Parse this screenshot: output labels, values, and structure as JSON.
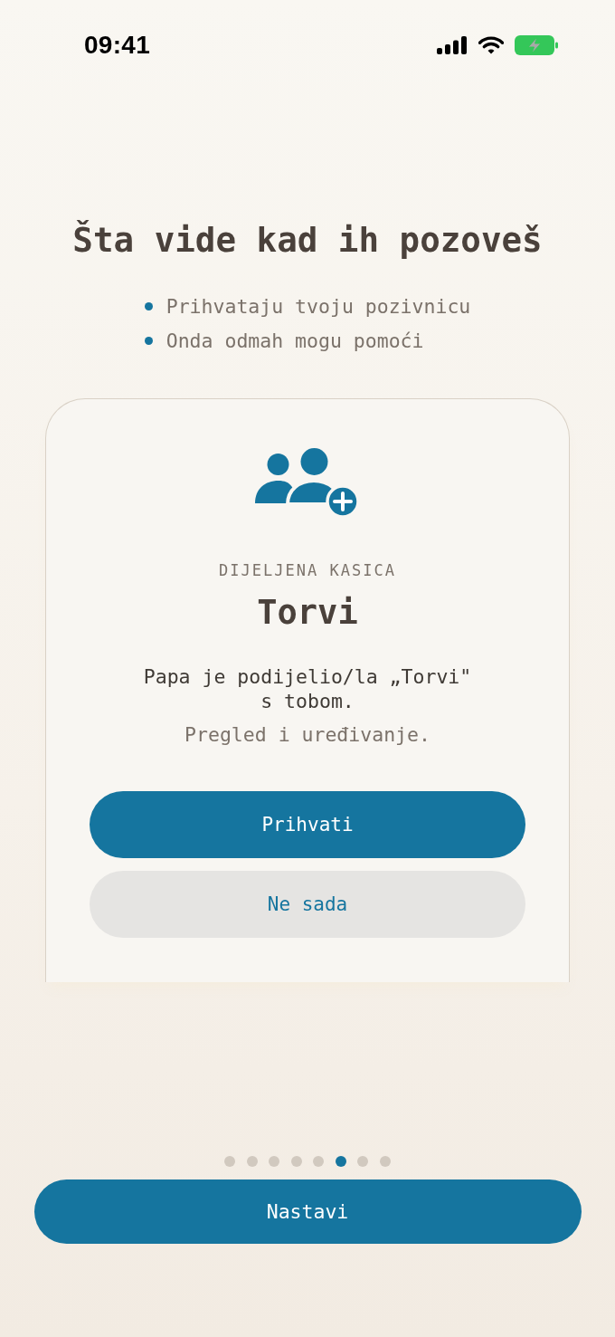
{
  "status_bar": {
    "time": "09:41"
  },
  "title": "Šta vide kad ih pozoveš",
  "bullets": [
    "Prihvataju tvoju pozivnicu",
    "Onda odmah mogu pomoći"
  ],
  "invite_card": {
    "eyebrow": "DIJELJENA KASICA",
    "name": "Torvi",
    "message": "Papa je podijelio/la „Torvi\" s tobom.",
    "note": "Pregled i uređivanje.",
    "buttons": [
      {
        "label": "Prihvati",
        "kind": "primary"
      },
      {
        "label": "Ne sada",
        "kind": "secondary"
      }
    ]
  },
  "pager": {
    "dots": [
      {
        "selected": false
      },
      {
        "selected": false
      },
      {
        "selected": false
      },
      {
        "selected": false
      },
      {
        "selected": false
      },
      {
        "selected": true
      },
      {
        "selected": false
      },
      {
        "selected": false
      }
    ]
  },
  "continue_button": {
    "label": "Nastavi"
  }
}
